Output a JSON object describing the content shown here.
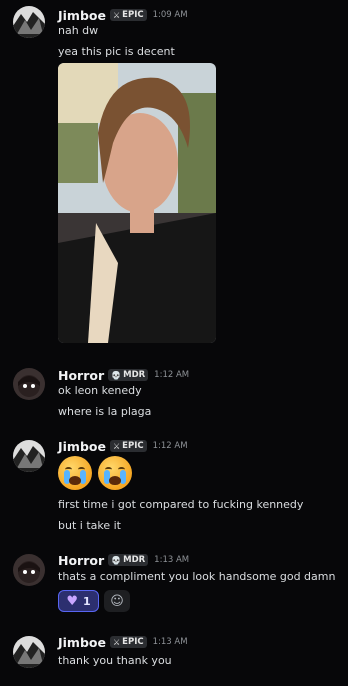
{
  "messages": [
    {
      "author": "Jimboe",
      "tag": "EPIC",
      "time": "1:09 AM",
      "lines": [
        "nah dw",
        "yea this pic is decent"
      ]
    },
    {
      "author": "Horror",
      "tag": "MDR",
      "time": "1:12 AM",
      "lines": [
        "ok leon kenedy",
        "where is la plaga"
      ]
    },
    {
      "author": "Jimboe",
      "tag": "EPIC",
      "time": "1:12 AM",
      "lines": [
        "first time i got compared to fucking kennedy",
        "but i take it"
      ]
    },
    {
      "author": "Horror",
      "tag": "MDR",
      "time": "1:13 AM",
      "lines": [
        "thats a compliment you look handsome god damn"
      ],
      "reaction": {
        "icon": "purple-heart",
        "count": "1"
      }
    },
    {
      "author": "Jimboe",
      "tag": "EPIC",
      "time": "1:13 AM",
      "lines": [
        "thank you thank you"
      ]
    }
  ],
  "colors": {
    "background": "#070709",
    "reaction_border": "#5865f2",
    "reaction_bg": "#2c2f6f"
  }
}
